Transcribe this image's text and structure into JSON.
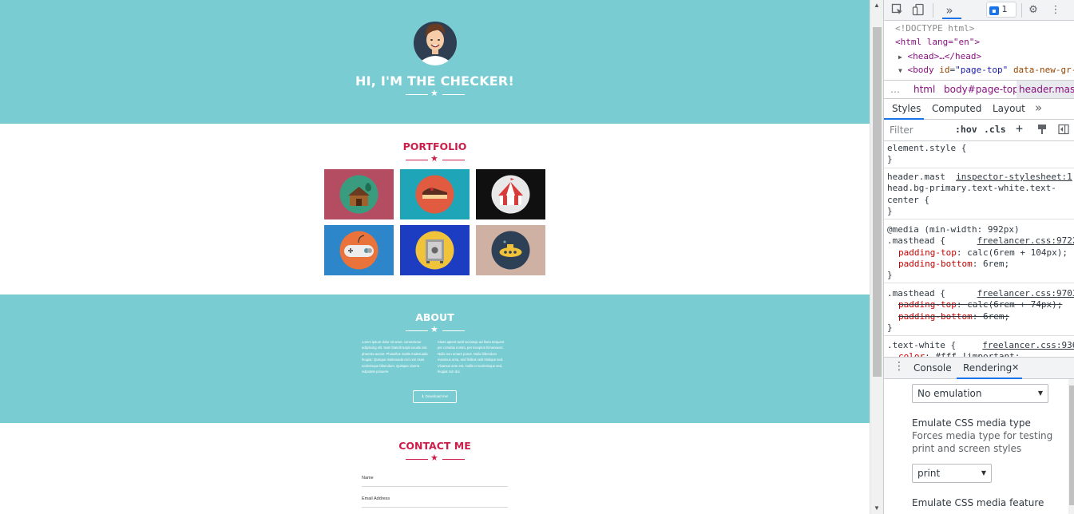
{
  "page": {
    "hero": {
      "title": "HI, I'M THE CHECKER!"
    },
    "portfolio": {
      "title": "PORTFOLIO",
      "tiles": [
        {
          "name": "cabin",
          "bg": "#b54d62",
          "circle": "#3a9c7e"
        },
        {
          "name": "cake",
          "bg": "#1fa5b8",
          "circle": "#e05b3f"
        },
        {
          "name": "circus",
          "bg": "#111010",
          "circle": "#e8e8e8"
        },
        {
          "name": "game",
          "bg": "#2d86c9",
          "circle": "#e9733a"
        },
        {
          "name": "safe",
          "bg": "#1c3cc2",
          "circle": "#f0c33a"
        },
        {
          "name": "submarine",
          "bg": "#cfb1a3",
          "circle": "#2e4055"
        }
      ]
    },
    "about": {
      "title": "ABOUT",
      "col1": "Lorem ipsum dolor sit amet, consectetur adipiscing elit. Nam blandit turpis iaculis nisi pharetra auctor. Phasellus mattis malesuada feugiat. Quisque malesuada orci non risus scelerisque bibendum. Quisque viverra vulputate posuere.",
      "col2": "Class aptent taciti sociosqu ad litora torquent per conubia nostra, per inceptos himenaeos. Nulla non ornare purus. Nulla bibendum maximus urna, sed finibus velit tristique sed. Vivamus ante est, mollis et scelerisque sed, feugiat non dui.",
      "button": "Download me!"
    },
    "contact": {
      "title": "CONTACT ME",
      "fields": [
        "Name",
        "Email Address"
      ]
    },
    "colors": {
      "teal": "#79cdd2",
      "accent": "#cc1e4a"
    }
  },
  "devtools": {
    "toolbar": {
      "message_count": "1"
    },
    "dom": {
      "doctype": "<!DOCTYPE html>",
      "html_open": "<html lang=\"en\">",
      "head": "<head>…</head>",
      "body_tag": "body",
      "body_attr1": "id",
      "body_val1": "\"page-top\"",
      "body_attr2": "data-new-gr-"
    },
    "breadcrumbs": [
      "…",
      "html",
      "body#page-top",
      "header.mas"
    ],
    "tabs": [
      "Styles",
      "Computed",
      "Layout"
    ],
    "filter": {
      "placeholder": "Filter",
      "hov": ":hov",
      "cls": ".cls",
      "plus": "+"
    },
    "rules": {
      "element_style": "element.style {",
      "close": "}",
      "r2_sel1": "header.mast",
      "r2_src": "inspector-stylesheet:1",
      "r2_sel2": "head.bg-primary.text-white.text-",
      "r2_sel3": "center {",
      "media_at": "@media",
      "media_cond": " (min-width: 992px)",
      "r3_sel": ".masthead {",
      "r3_src": "freelancer.css:9722",
      "r3_p1n": "padding-top",
      "r3_p1v": "calc(6rem + 104px);",
      "r3_p2n": "padding-bottom",
      "r3_p2v": "6rem;",
      "r4_sel": ".masthead {",
      "r4_src": "freelancer.css:9703",
      "r4_p1n": "padding-top",
      "r4_p1v": "calc(6rem + 74px);",
      "r4_p2n": "padding-bottom",
      "r4_p2v": "6rem;",
      "r5_sel": ".text-white {",
      "r5_src": "freelancer.css:9362",
      "r5_p1n": "color",
      "r5_p1v": "#fff !important;"
    },
    "drawer": {
      "tab1": "Console",
      "tab2": "Rendering"
    },
    "rendering": {
      "emulation_select": "No emulation",
      "media_type_title": "Emulate CSS media type",
      "media_type_desc1": "Forces media type for testing",
      "media_type_desc2": "print and screen styles",
      "media_type_select": "print",
      "media_feature_title": "Emulate CSS media feature"
    }
  }
}
